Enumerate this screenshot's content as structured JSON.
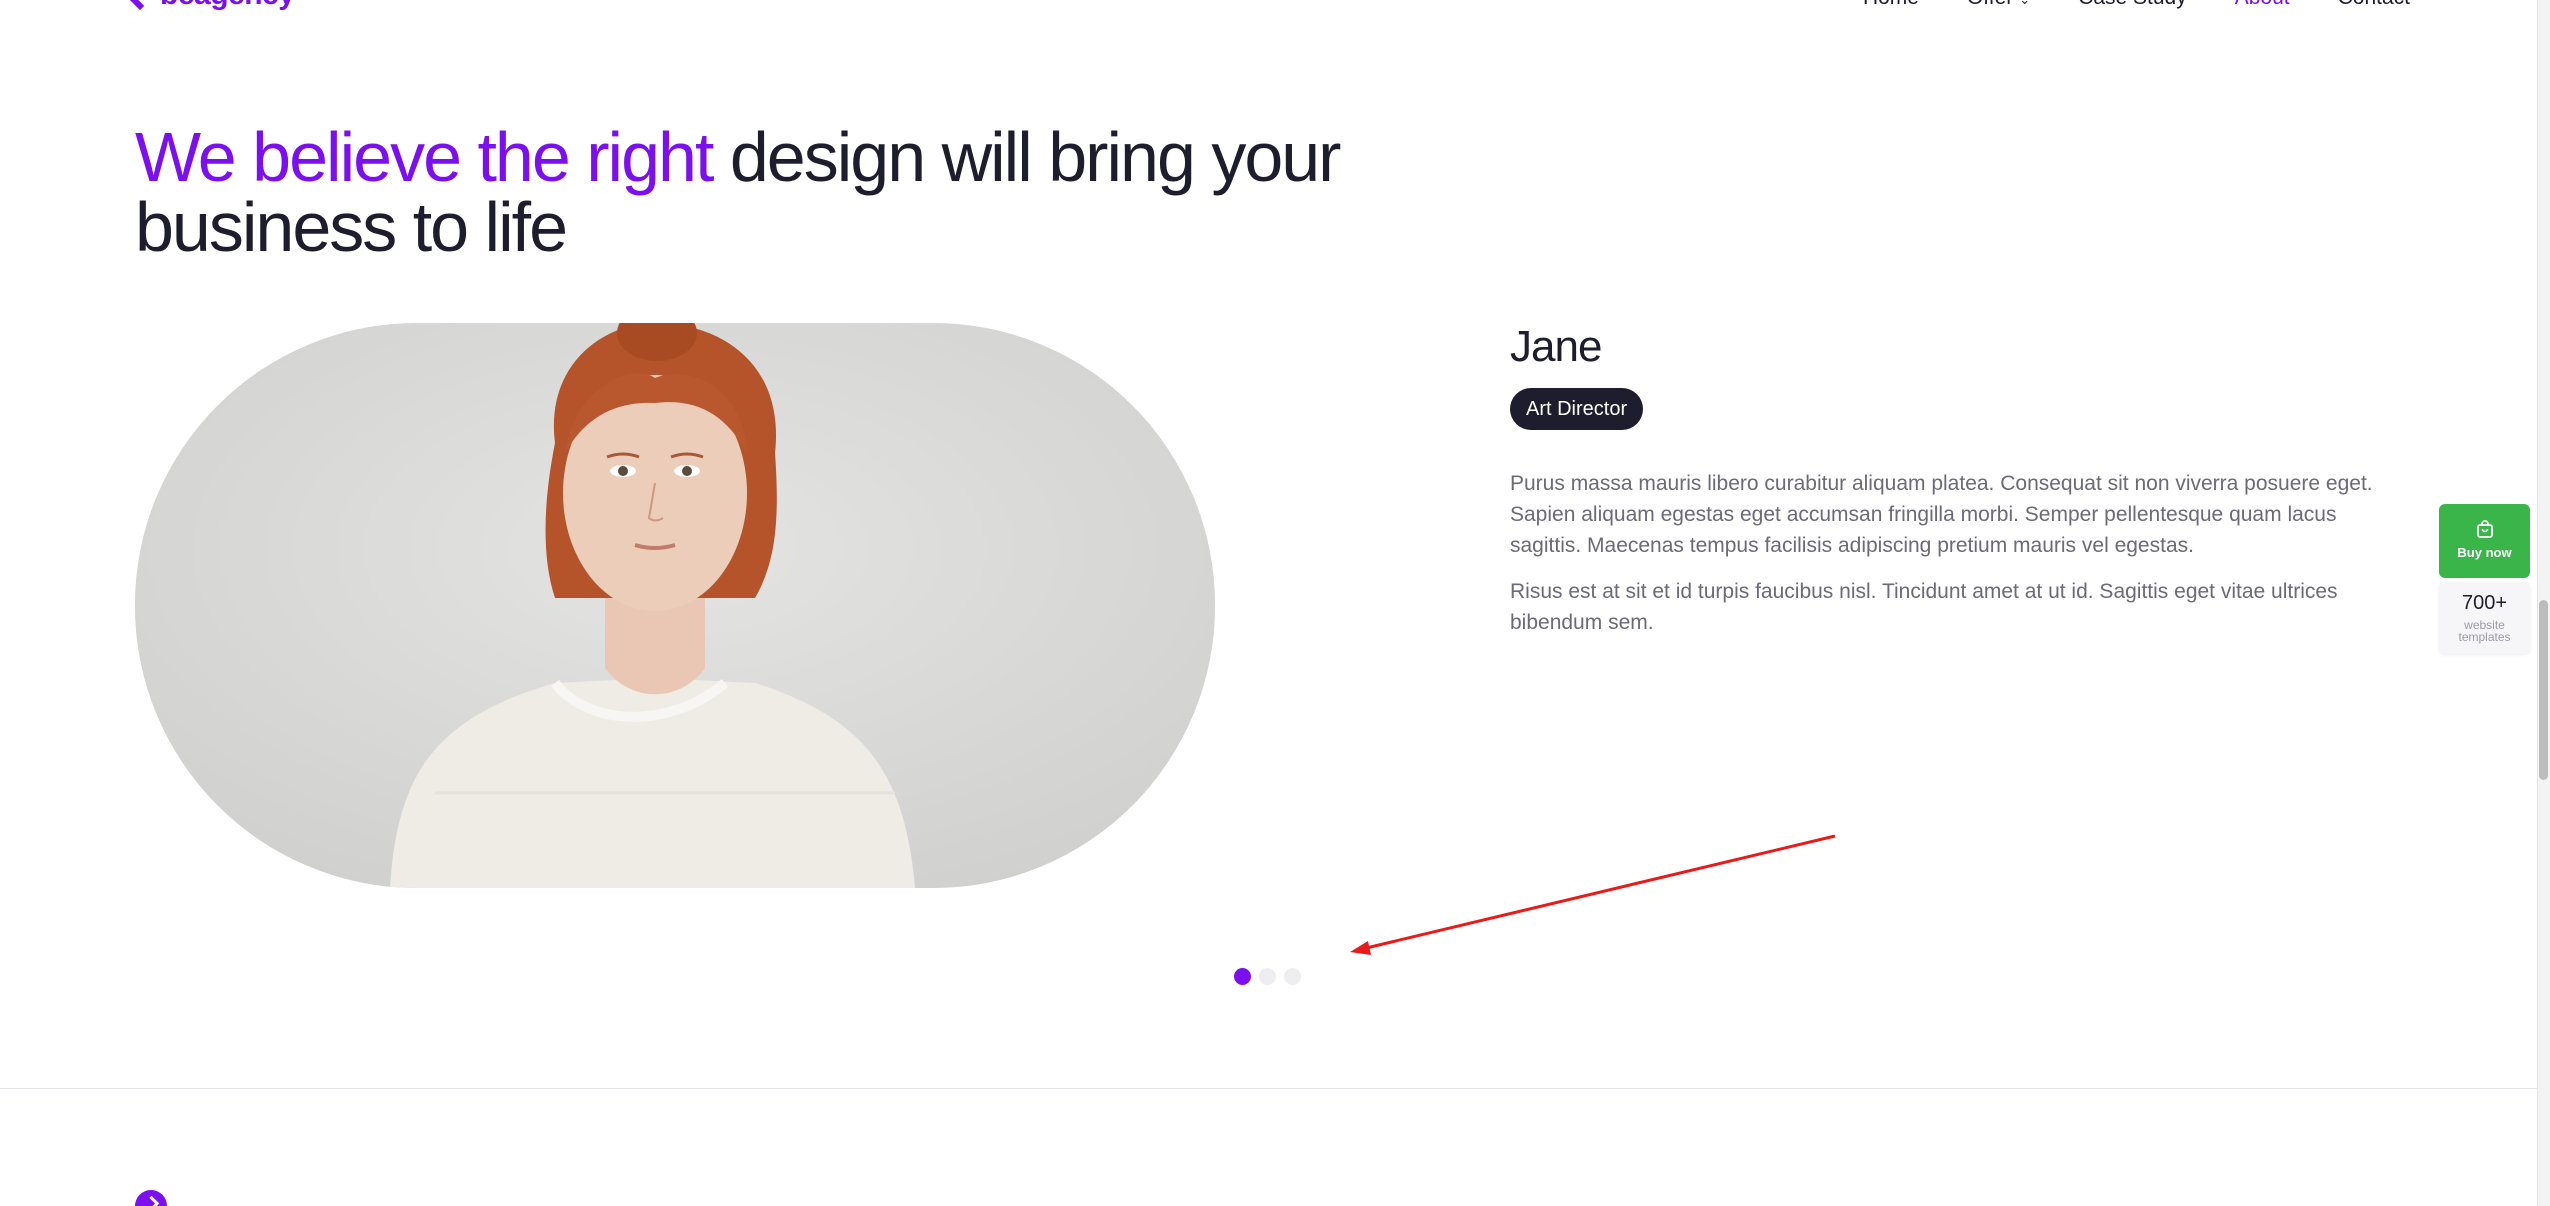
{
  "brand": {
    "name": "beagency",
    "accent_color": "#7b0ff0"
  },
  "nav": {
    "items": [
      {
        "label": "Home"
      },
      {
        "label": "Offer"
      },
      {
        "label": "Case Study"
      },
      {
        "label": "About"
      },
      {
        "label": "Contact"
      }
    ],
    "active": "About"
  },
  "hero": {
    "title_accent": "We believe the right",
    "title_rest": "design will bring your business to life"
  },
  "profile": {
    "name": "Jane",
    "role": "Art Director",
    "bio": [
      "Purus massa mauris libero curabitur aliquam platea. Consequat sit non viverra posuere eget. Sapien aliquam egestas eget accumsan fringilla morbi. Semper pellentesque quam lacus sagittis. Maecenas tempus facilisis adipiscing pretium mauris vel egestas.",
      "Risus est at sit et id turpis faucibus nisl. Tincidunt amet at ut id. Sagittis eget vitae ultrices bibendum sem."
    ]
  },
  "carousel": {
    "total": 3,
    "active_index": 0
  },
  "widget": {
    "buy_label": "Buy now",
    "buy_color": "#3ab54a",
    "template_count": "700+",
    "template_label": "website templates"
  },
  "annotation": {
    "arrow_color": "#e81a1a"
  }
}
